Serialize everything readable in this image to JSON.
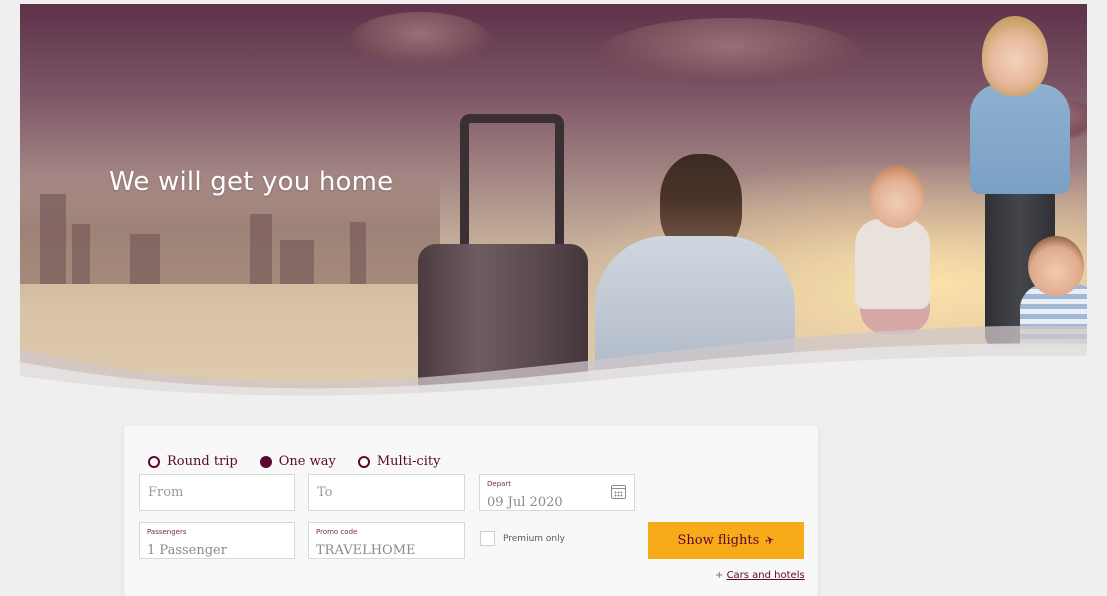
{
  "hero": {
    "title": "We will get you home"
  },
  "booking": {
    "trip_types": [
      {
        "label": "Round trip",
        "checked": false
      },
      {
        "label": "One way",
        "checked": true
      },
      {
        "label": "Multi-city",
        "checked": false
      }
    ],
    "from": {
      "placeholder": "From"
    },
    "to": {
      "placeholder": "To"
    },
    "depart": {
      "label": "Depart",
      "value": "09 Jul 2020",
      "icon": "calendar-icon"
    },
    "passengers": {
      "label": "Passengers",
      "value": "1 Passenger"
    },
    "promo": {
      "label": "Promo code",
      "value": "TRAVELHOME"
    },
    "premium_only": {
      "label": "Premium only",
      "checked": false
    },
    "show_flights": {
      "label": "Show flights",
      "icon": "plane-icon"
    },
    "cars_link": {
      "prefix": "+ ",
      "label": "Cars and hotels"
    }
  },
  "colors": {
    "brand": "#5c0632",
    "accent": "#f7ab19",
    "background": "#efefef"
  }
}
